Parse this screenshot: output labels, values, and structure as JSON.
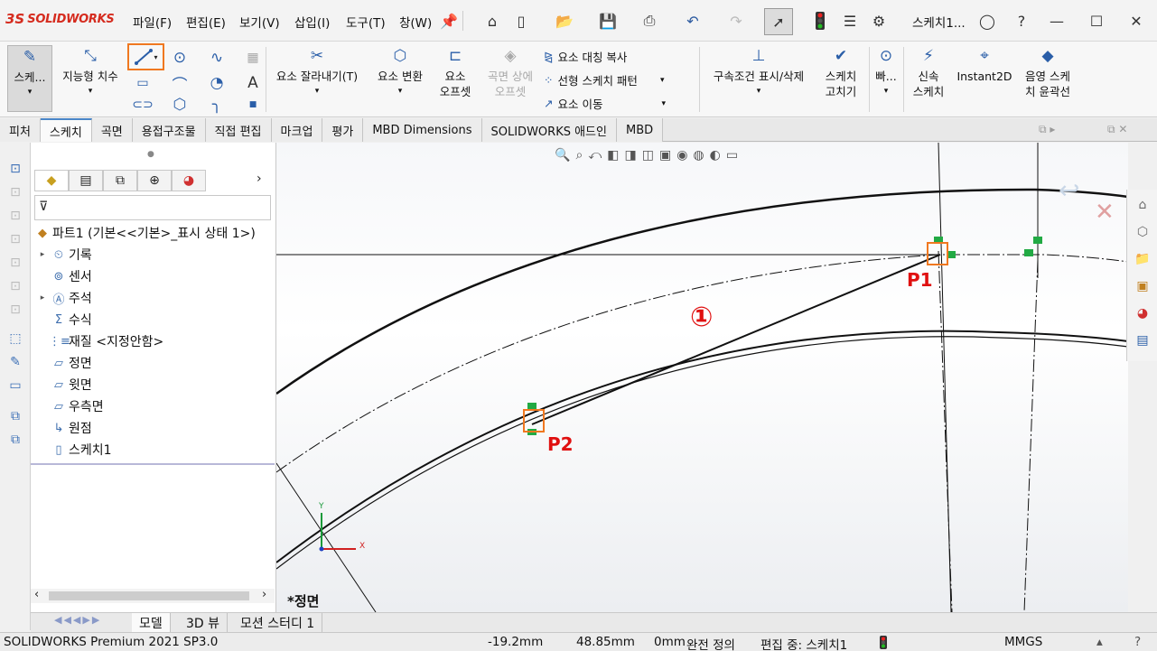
{
  "title_bar": {
    "logo_mark": "3S",
    "logo_text": "SOLIDWORKS",
    "menus": [
      "파일(F)",
      "편집(E)",
      "보기(V)",
      "삽입(I)",
      "도구(T)",
      "창(W)"
    ],
    "doc_title": "스케치1..."
  },
  "ribbon": {
    "sketch_label": "스케...",
    "smart_dim_label": "지능형 치수",
    "trim_label": "요소 잘라내기(T)",
    "convert_label": "요소 변환",
    "offset_label_1": "요소",
    "offset_label_2": "오프셋",
    "surface_offset_label_1": "곡면 상에",
    "surface_offset_label_2": "오프셋",
    "mirror_label": "요소 대칭 복사",
    "pattern_label": "선형 스케치 패턴",
    "move_label": "요소 이동",
    "relations_label": "구속조건 표시/삭제",
    "repair_label_1": "스케치",
    "repair_label_2": "고치기",
    "quick_label": "빠...",
    "rapid_label_1": "신속",
    "rapid_label_2": "스케치",
    "instant2d_label": "Instant2D",
    "shaded_label_1": "음영 스케",
    "shaded_label_2": "치 윤곽선"
  },
  "tabs": [
    {
      "label": "피처",
      "active": false
    },
    {
      "label": "스케치",
      "active": true
    },
    {
      "label": "곡면",
      "active": false
    },
    {
      "label": "용접구조물",
      "active": false
    },
    {
      "label": "직접 편집",
      "active": false
    },
    {
      "label": "마크업",
      "active": false
    },
    {
      "label": "평가",
      "active": false
    },
    {
      "label": "MBD Dimensions",
      "active": false
    },
    {
      "label": "SOLIDWORKS 애드인",
      "active": false
    },
    {
      "label": "MBD",
      "active": false
    }
  ],
  "feature_tree": {
    "root": "파트1  (기본<<기본>_표시 상태 1>)",
    "items": [
      {
        "label": "기록",
        "expandable": true,
        "icon": "history-icon"
      },
      {
        "label": "센서",
        "expandable": false,
        "icon": "sensor-icon"
      },
      {
        "label": "주석",
        "expandable": true,
        "icon": "annotation-icon"
      },
      {
        "label": "수식",
        "expandable": false,
        "icon": "equation-icon"
      },
      {
        "label": "재질 <지정안함>",
        "expandable": false,
        "icon": "material-icon"
      },
      {
        "label": "정면",
        "expandable": false,
        "icon": "plane-icon"
      },
      {
        "label": "윗면",
        "expandable": false,
        "icon": "plane-icon"
      },
      {
        "label": "우측면",
        "expandable": false,
        "icon": "plane-icon"
      },
      {
        "label": "원점",
        "expandable": false,
        "icon": "origin-icon"
      },
      {
        "label": "스케치1",
        "expandable": false,
        "icon": "sketch-icon"
      }
    ]
  },
  "graphics": {
    "view_name": "*정면",
    "annotations": {
      "p1": "P1",
      "p2": "P2",
      "step": "①"
    },
    "axis_x": "X",
    "axis_y": "Y"
  },
  "bottom_tabs": [
    "모델",
    "3D 뷰",
    "모션 스터디 1"
  ],
  "status": {
    "product": "SOLIDWORKS Premium 2021 SP3.0",
    "x": "-19.2mm",
    "y": "48.85mm",
    "z": "0mm",
    "definition": "완전 정의",
    "editing": "편집 중: 스케치1",
    "units": "MMGS"
  },
  "colors": {
    "accent": "#f07820",
    "annotation_red": "#e01010",
    "relation_green": "#22aa44",
    "brand_red": "#d52b1e"
  }
}
